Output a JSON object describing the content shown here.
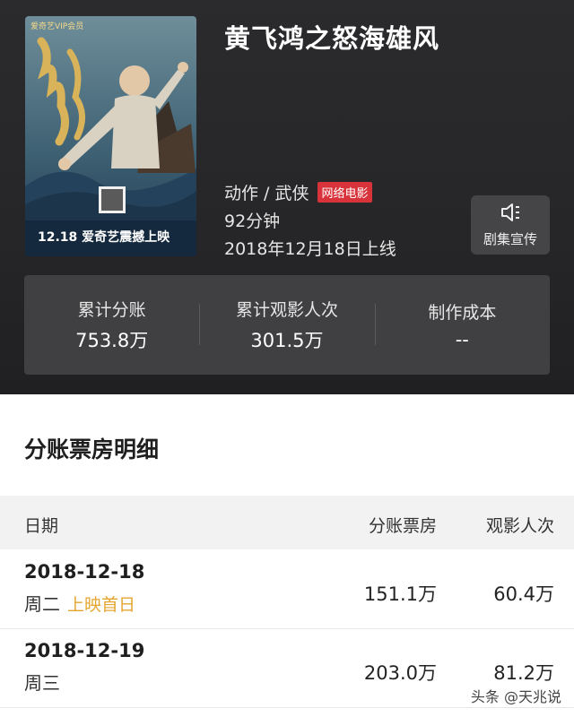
{
  "movie": {
    "title": "黄飞鸿之怒海雄风",
    "genre": "动作 / 武侠",
    "badge": "网络电影",
    "duration": "92分钟",
    "release": "2018年12月18日上线",
    "promo_label": "剧集宣传",
    "poster_text": {
      "top_tag": "爱奇艺VIP会员",
      "release_banner": "12.18 爱奇艺震撼上映"
    }
  },
  "stats": [
    {
      "label": "累计分账",
      "value": "753.8万"
    },
    {
      "label": "累计观影人次",
      "value": "301.5万"
    },
    {
      "label": "制作成本",
      "value": "--"
    }
  ],
  "detail": {
    "title": "分账票房明细",
    "headers": {
      "date": "日期",
      "box": "分账票房",
      "views": "观影人次"
    },
    "rows": [
      {
        "date": "2018-12-18",
        "weekday": "周二",
        "tag": "上映首日",
        "box": "151.1万",
        "views": "60.4万"
      },
      {
        "date": "2018-12-19",
        "weekday": "周三",
        "tag": "",
        "box": "203.0万",
        "views": "81.2万"
      }
    ]
  },
  "watermark": "头条 @天兆说",
  "colors": {
    "badge": "#d8333a",
    "first_day_tag": "#e5a630",
    "hero_bg": "#2b2b2d"
  }
}
